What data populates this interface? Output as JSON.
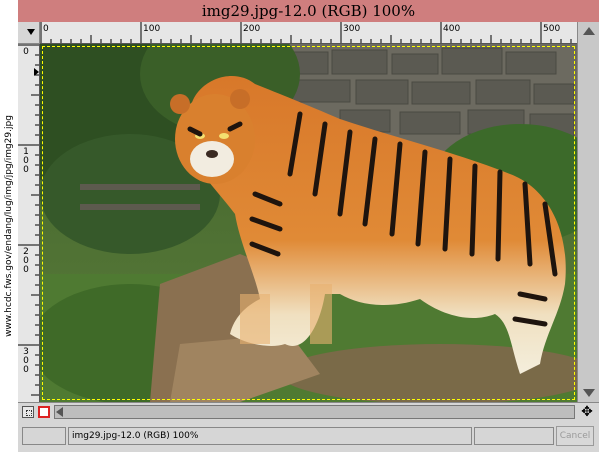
{
  "side_caption": "www.hcdc.fws.gov/endang/lug/img/jpg/img29.jpg",
  "window": {
    "title": "img29.jpg-12.0 (RGB) 100%"
  },
  "rulers": {
    "horizontal_labels": [
      "0",
      "100",
      "200",
      "300",
      "400",
      "500"
    ],
    "vertical_labels": [
      "0",
      "100",
      "200",
      "300"
    ]
  },
  "canvas": {
    "image_description_icon": "tiger-photo"
  },
  "statusbar": {
    "text": "img29.jpg-12.0 (RGB) 100%",
    "cancel_label": "Cancel"
  }
}
